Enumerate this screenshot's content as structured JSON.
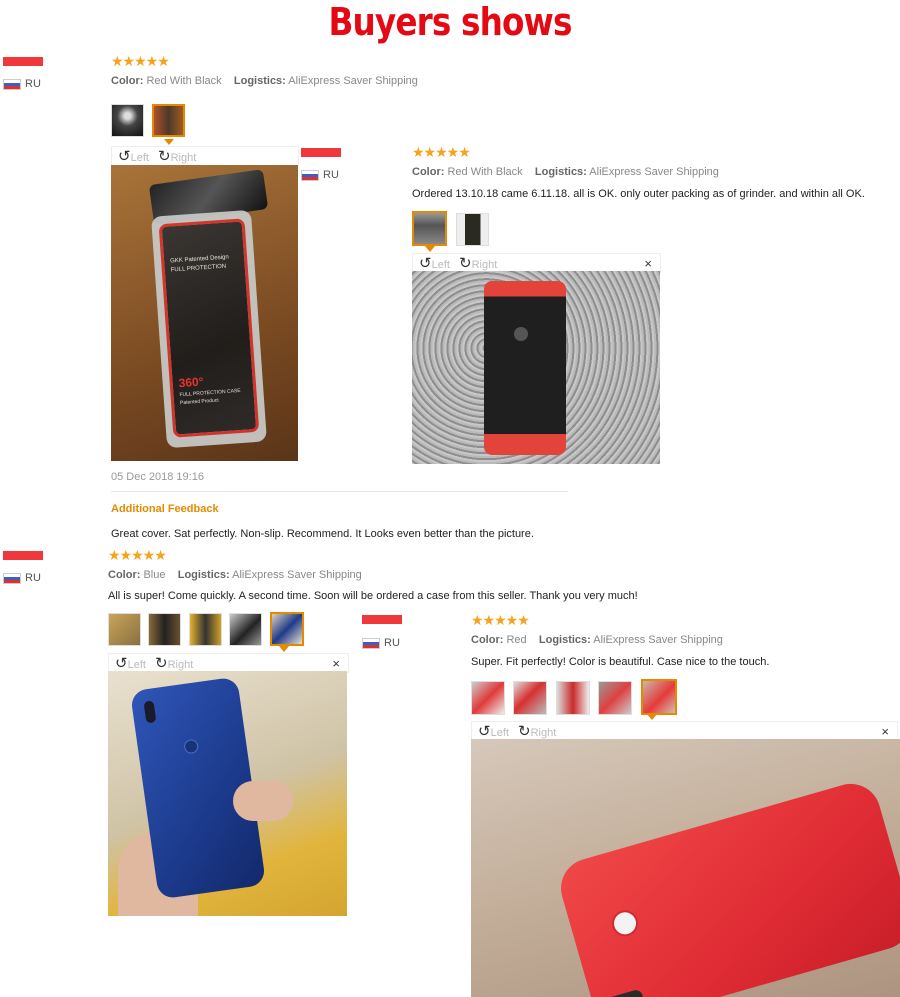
{
  "header": {
    "title": "Buyers shows"
  },
  "colors": {
    "accent": "#e50914",
    "star": "#f6a21a",
    "selected": "#e58a00"
  },
  "reviews": [
    {
      "country": "RU",
      "stars": "★★★★★",
      "color_label": "Color:",
      "color_value": "Red With Black",
      "logistics_label": "Logistics:",
      "logistics_value": "AliExpress Saver Shipping",
      "left_label": "Left",
      "right_label": "Right",
      "date": "05 Dec 2018 19:16",
      "additional_label": "Additional Feedback",
      "additional_text": "Great cover. Sat perfectly. Non-slip. Recommend. It Looks even better than the picture."
    },
    {
      "country": "RU",
      "stars": "★★★★★",
      "color_label": "Color:",
      "color_value": "Red With Black",
      "logistics_label": "Logistics:",
      "logistics_value": "AliExpress Saver Shipping",
      "text": "Ordered 13.10.18 came 6.11.18. all is OK. only outer packing as of grinder. and within all OK.",
      "left_label": "Left",
      "right_label": "Right",
      "close": "×"
    },
    {
      "country": "RU",
      "stars": "★★★★★",
      "color_label": "Color:",
      "color_value": "Blue",
      "logistics_label": "Logistics:",
      "logistics_value": "AliExpress Saver Shipping",
      "text": "All is super! Come quickly. A second time. Soon will be ordered a case from this seller. Thank you very much!",
      "left_label": "Left",
      "right_label": "Right",
      "close": "×"
    },
    {
      "country": "RU",
      "stars": "★★★★★",
      "color_label": "Color:",
      "color_value": "Red",
      "logistics_label": "Logistics:",
      "logistics_value": "AliExpress Saver Shipping",
      "text": "Super. Fit perfectly! Color is beautiful. Case nice to the touch.",
      "left_label": "Left",
      "right_label": "Right",
      "close": "×"
    }
  ],
  "photo_print": {
    "line1": "GKK Patented Design",
    "line2": "FULL PROTECTION",
    "big": "360°",
    "line3": "FULL PROTECTION CASE",
    "line4": "Patented Product"
  }
}
